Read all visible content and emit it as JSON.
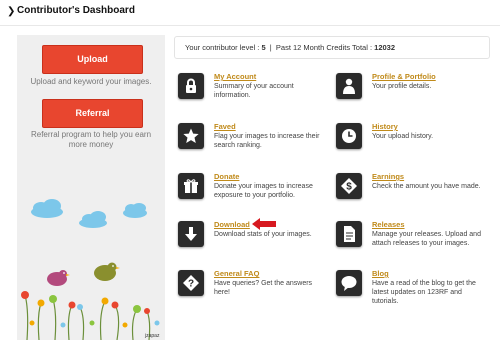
{
  "header": {
    "title": "Contributor's Dashboard"
  },
  "sidebar": {
    "upload_label": "Upload",
    "upload_text": "Upload and keyword your images.",
    "referral_label": "Referral",
    "referral_text": "Referral program to help you earn more money",
    "art_caption": "jzapaz"
  },
  "level": {
    "level_label": "Your contributor level : ",
    "level_value": "5",
    "separator": "  |  ",
    "credits_label": "Past 12 Month Credits Total : ",
    "credits_value": "12032"
  },
  "items": [
    {
      "title": "My Account",
      "desc": "Summary of your account information.",
      "icon": "lock-icon"
    },
    {
      "title": "Profile & Portfolio",
      "desc": "Your profile details.",
      "icon": "user-icon"
    },
    {
      "title": "Faved",
      "desc": "Flag your images to increase their search ranking.",
      "icon": "star-icon"
    },
    {
      "title": "History",
      "desc": "Your upload history.",
      "icon": "clock-icon"
    },
    {
      "title": "Donate",
      "desc": "Donate your images to increase exposure to your portfolio.",
      "icon": "gift-icon"
    },
    {
      "title": "Earnings",
      "desc": "Check the amount you have made.",
      "icon": "dollar-icon"
    },
    {
      "title": "Download",
      "desc": "Download stats of your images.",
      "icon": "download-arrow-icon"
    },
    {
      "title": "Releases",
      "desc": "Manage your releases. Upload and attach releases to your images.",
      "icon": "document-icon"
    },
    {
      "title": "General FAQ",
      "desc": "Have queries? Get the answers here!",
      "icon": "question-icon"
    },
    {
      "title": "Blog",
      "desc": "Have a read of the blog to get the latest updates on 123RF and tutorials.",
      "icon": "speech-bubble-icon"
    }
  ],
  "colors": {
    "accent": "#e8462f",
    "link": "#c08a1a",
    "icon_bg": "#2b2b2b"
  }
}
